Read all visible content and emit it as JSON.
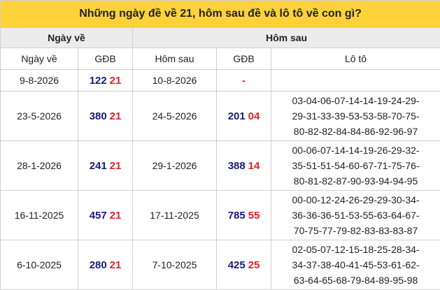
{
  "title": "Những ngày đề về 21, hôm sau đề và lô tô về con gì?",
  "group_headers": {
    "left": "Ngày về",
    "right": "Hôm sau"
  },
  "column_headers": {
    "date": "Ngày về",
    "gdb": "GĐB",
    "next_date": "Hôm sau",
    "next_gdb": "GĐB",
    "loto": "Lô tô"
  },
  "colors": {
    "header_yellow": "#ffd23a",
    "group_gray": "#ececec",
    "number_dark": "#1a1a7a",
    "number_red": "#e0202c",
    "loto_blue": "#2c3fb0"
  },
  "rows": [
    {
      "date": "9-8-2026",
      "gdb_prefix": "122",
      "gdb_suffix": "21",
      "next_date": "10-8-2026",
      "next_prefix": "",
      "next_suffix": "-",
      "loto_lines": [
        "",
        "",
        ""
      ]
    },
    {
      "date": "23-5-2026",
      "gdb_prefix": "380",
      "gdb_suffix": "21",
      "next_date": "24-5-2026",
      "next_prefix": "201",
      "next_suffix": "04",
      "loto_lines": [
        "03-04-06-07-14-14-19-24-29-",
        "29-31-33-39-53-53-58-70-75-",
        "80-82-82-84-84-86-92-96-97"
      ]
    },
    {
      "date": "28-1-2026",
      "gdb_prefix": "241",
      "gdb_suffix": "21",
      "next_date": "29-1-2026",
      "next_prefix": "388",
      "next_suffix": "14",
      "loto_lines": [
        "00-06-07-14-14-19-26-29-32-",
        "35-51-51-54-60-67-71-75-76-",
        "80-81-82-87-90-93-94-94-95"
      ]
    },
    {
      "date": "16-11-2025",
      "gdb_prefix": "457",
      "gdb_suffix": "21",
      "next_date": "17-11-2025",
      "next_prefix": "785",
      "next_suffix": "55",
      "loto_lines": [
        "00-00-12-24-26-29-29-30-34-",
        "36-36-36-51-53-55-63-64-67-",
        "70-75-77-79-82-83-83-83-87"
      ]
    },
    {
      "date": "6-10-2025",
      "gdb_prefix": "280",
      "gdb_suffix": "21",
      "next_date": "7-10-2025",
      "next_prefix": "425",
      "next_suffix": "25",
      "loto_lines": [
        "02-05-07-12-15-18-25-28-34-",
        "34-37-38-40-41-45-53-61-62-",
        "63-64-65-68-79-84-89-95-98"
      ]
    }
  ]
}
